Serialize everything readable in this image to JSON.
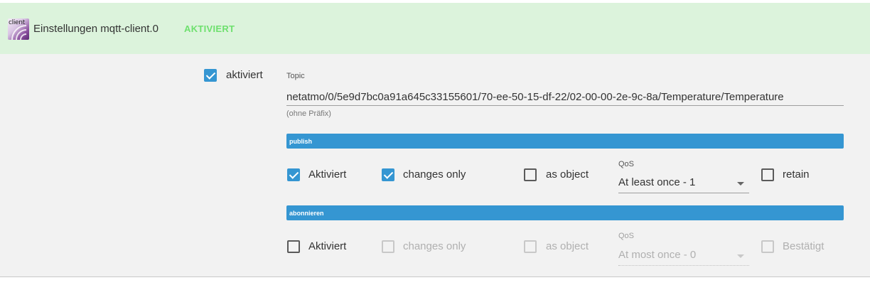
{
  "header": {
    "icon_text": "client",
    "title": "Einstellungen mqtt-client.0",
    "status": "AKTIVIERT",
    "status_color": "#6ee06e",
    "background": "#dcf3dc"
  },
  "main": {
    "enabled": {
      "label": "aktiviert",
      "checked": true
    },
    "topic": {
      "label": "Topic",
      "value": "netatmo/0/5e9d7bc0a91a645c33155601/70-ee-50-15-df-22/02-00-00-2e-9c-8a/Temperature/Temperature",
      "hint": "(ohne Präfix)"
    },
    "publish": {
      "title": "publish",
      "enabled": {
        "label": "Aktiviert",
        "checked": true
      },
      "changes_only": {
        "label": "changes only",
        "checked": true
      },
      "as_object": {
        "label": "as object",
        "checked": false
      },
      "qos": {
        "label": "QoS",
        "value": "At least once - 1"
      },
      "retain": {
        "label": "retain",
        "checked": false
      }
    },
    "subscribe": {
      "title": "abonnieren",
      "enabled": {
        "label": "Aktiviert",
        "checked": false
      },
      "changes_only": {
        "label": "changes only",
        "checked": false,
        "disabled": true
      },
      "as_object": {
        "label": "as object",
        "checked": false,
        "disabled": true
      },
      "qos": {
        "label": "QoS",
        "value": "At most once - 0",
        "disabled": true
      },
      "ack": {
        "label": "Bestätigt",
        "checked": false,
        "disabled": true
      }
    }
  },
  "colors": {
    "accent": "#3596d2",
    "content_background": "#f2f2f2"
  }
}
